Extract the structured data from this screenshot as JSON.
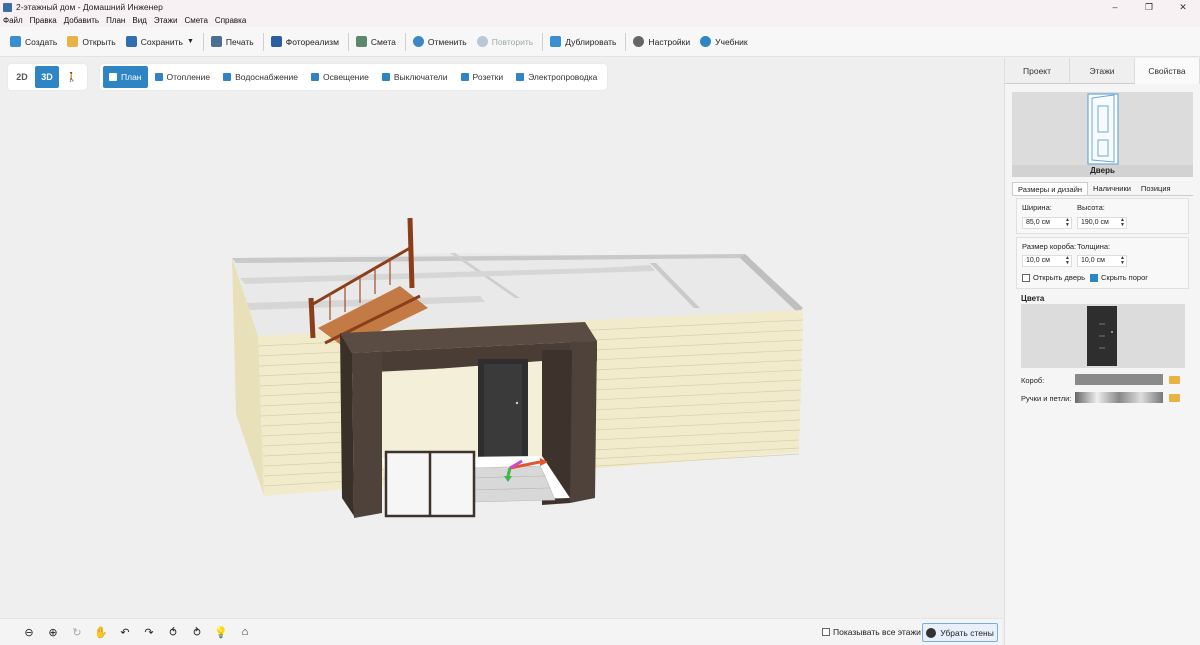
{
  "window": {
    "title": "2-этажный дом - Домашний Инженер",
    "controls": [
      "–",
      "❐",
      "✕"
    ]
  },
  "menu": [
    "Файл",
    "Правка",
    "Добавить",
    "План",
    "Вид",
    "Этажи",
    "Смета",
    "Справка"
  ],
  "toolbar": {
    "create": "Создать",
    "open": "Открыть",
    "save": "Сохранить",
    "print": "Печать",
    "photoreal": "Фотореализм",
    "estimate": "Смета",
    "undo": "Отменить",
    "redo": "Повторить",
    "duplicate": "Дублировать",
    "settings": "Настройки",
    "tutorial": "Учебник"
  },
  "view_modes": {
    "m2d": "2D",
    "m3d": "3D",
    "walk": "🚶",
    "active": "3D"
  },
  "layers": [
    "План",
    "Отопление",
    "Водоснабжение",
    "Освещение",
    "Выключатели",
    "Розетки",
    "Электропроводка"
  ],
  "active_layer": "План",
  "bottom": {
    "show_all_floors": "Показывать все этажи",
    "hide_walls": "Убрать стены"
  },
  "panel": {
    "tabs": [
      "Проект",
      "Этажи",
      "Свойства"
    ],
    "active_tab": "Свойства",
    "object_name": "Дверь",
    "subtabs": [
      "Размеры и дизайн",
      "Наличники",
      "Позиция"
    ],
    "width_label": "Ширина:",
    "width_value": "85,0 см",
    "height_label": "Высота:",
    "height_value": "190,0 см",
    "frame_label": "Размер короба:",
    "frame_value": "10,0 см",
    "thick_label": "Толщина:",
    "thick_value": "10,0 см",
    "open_door": "Открыть дверь",
    "hide_sill": "Скрыть порог",
    "colors_title": "Цвета",
    "frame_color_label": "Короб:",
    "handles_label": "Ручки и петли:"
  },
  "colors": {
    "accent": "#2f84c4",
    "siding": "#f1ebcb",
    "wood": "#4a3d35",
    "stair": "#b05a2a",
    "door": "#2e2e2e"
  }
}
